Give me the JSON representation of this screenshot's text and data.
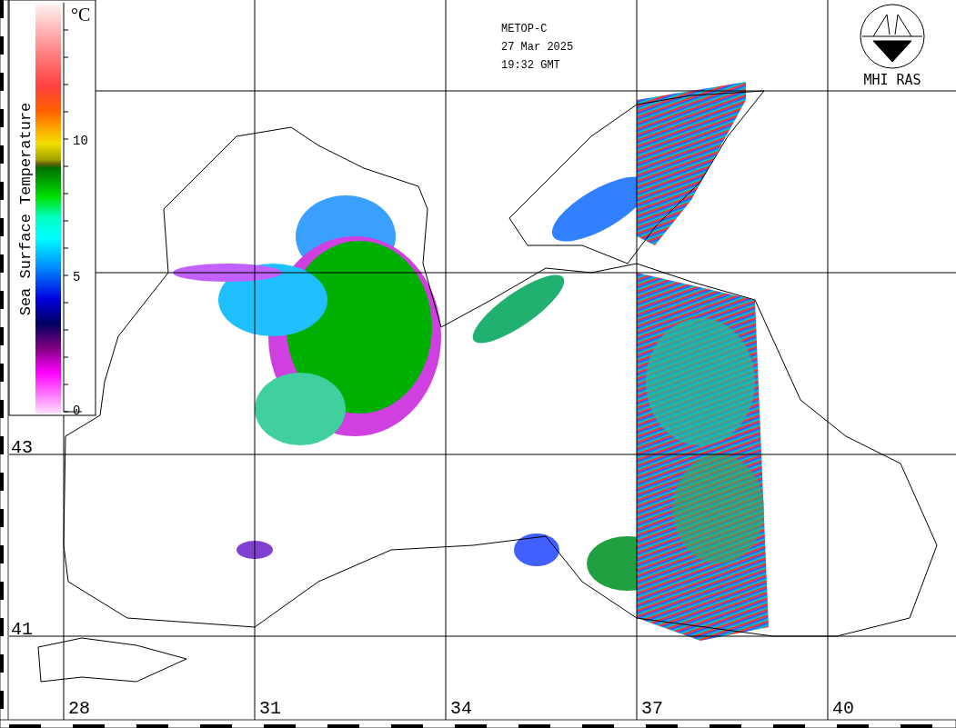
{
  "header": {
    "satellite": "METOP-C",
    "date": "27 Mar 2025",
    "time": "19:32 GMT"
  },
  "logo": {
    "text": "MHI RAS"
  },
  "colorbar": {
    "title": "Sea Surface Temperature",
    "unit": "°C",
    "ticks": [
      "10",
      "5",
      "0"
    ]
  },
  "latitude_labels": [
    "43",
    "41"
  ],
  "longitude_labels": [
    "28",
    "31",
    "34",
    "37",
    "40"
  ]
}
